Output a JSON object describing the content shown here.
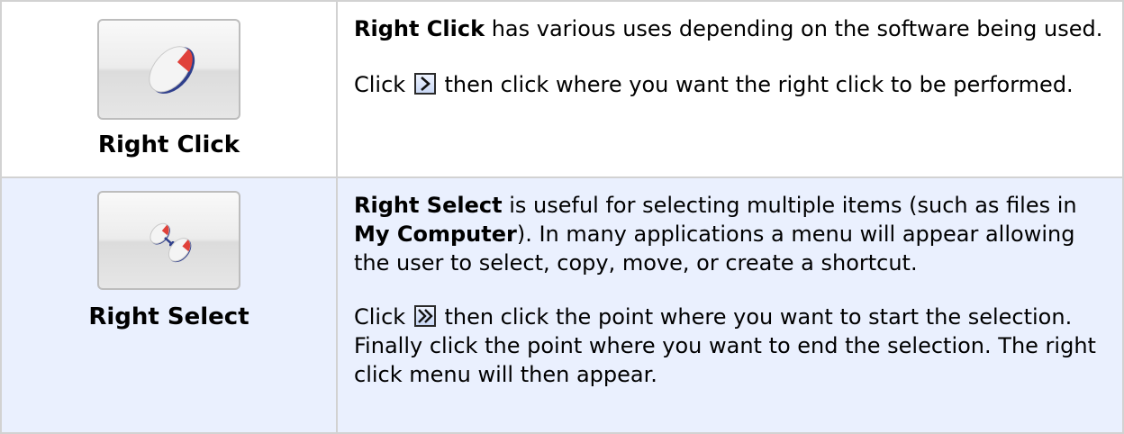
{
  "rows": [
    {
      "tool_label": "Right Click",
      "desc": {
        "p1_bold": "Right Click",
        "p1_text": " has various uses depending on the software being used.",
        "p2_before": "Click ",
        "p2_after": " then click where you want the right click to be performed."
      },
      "icon": "right-click-mouse-icon",
      "inline_icon": "chevron-right-icon"
    },
    {
      "tool_label": "Right Select",
      "desc": {
        "p1_bold": "Right Select",
        "p1_text_a": " is useful for selecting multiple items (such as files in ",
        "p1_bold2": "My Computer",
        "p1_text_b": ").  In many applications a menu will appear allowing the user to select, copy, move, or create a shortcut.",
        "p2_before": "Click ",
        "p2_after": " then click the point where you want to start the selection.  Finally click the point where you want to end the selection. The right click menu will then appear."
      },
      "icon": "right-select-mouse-icon",
      "inline_icon": "double-chevron-right-icon"
    }
  ],
  "colors": {
    "row_highlight": "#eaf0fe",
    "mouse_red": "#e0413a",
    "border": "#d2d2d2"
  }
}
